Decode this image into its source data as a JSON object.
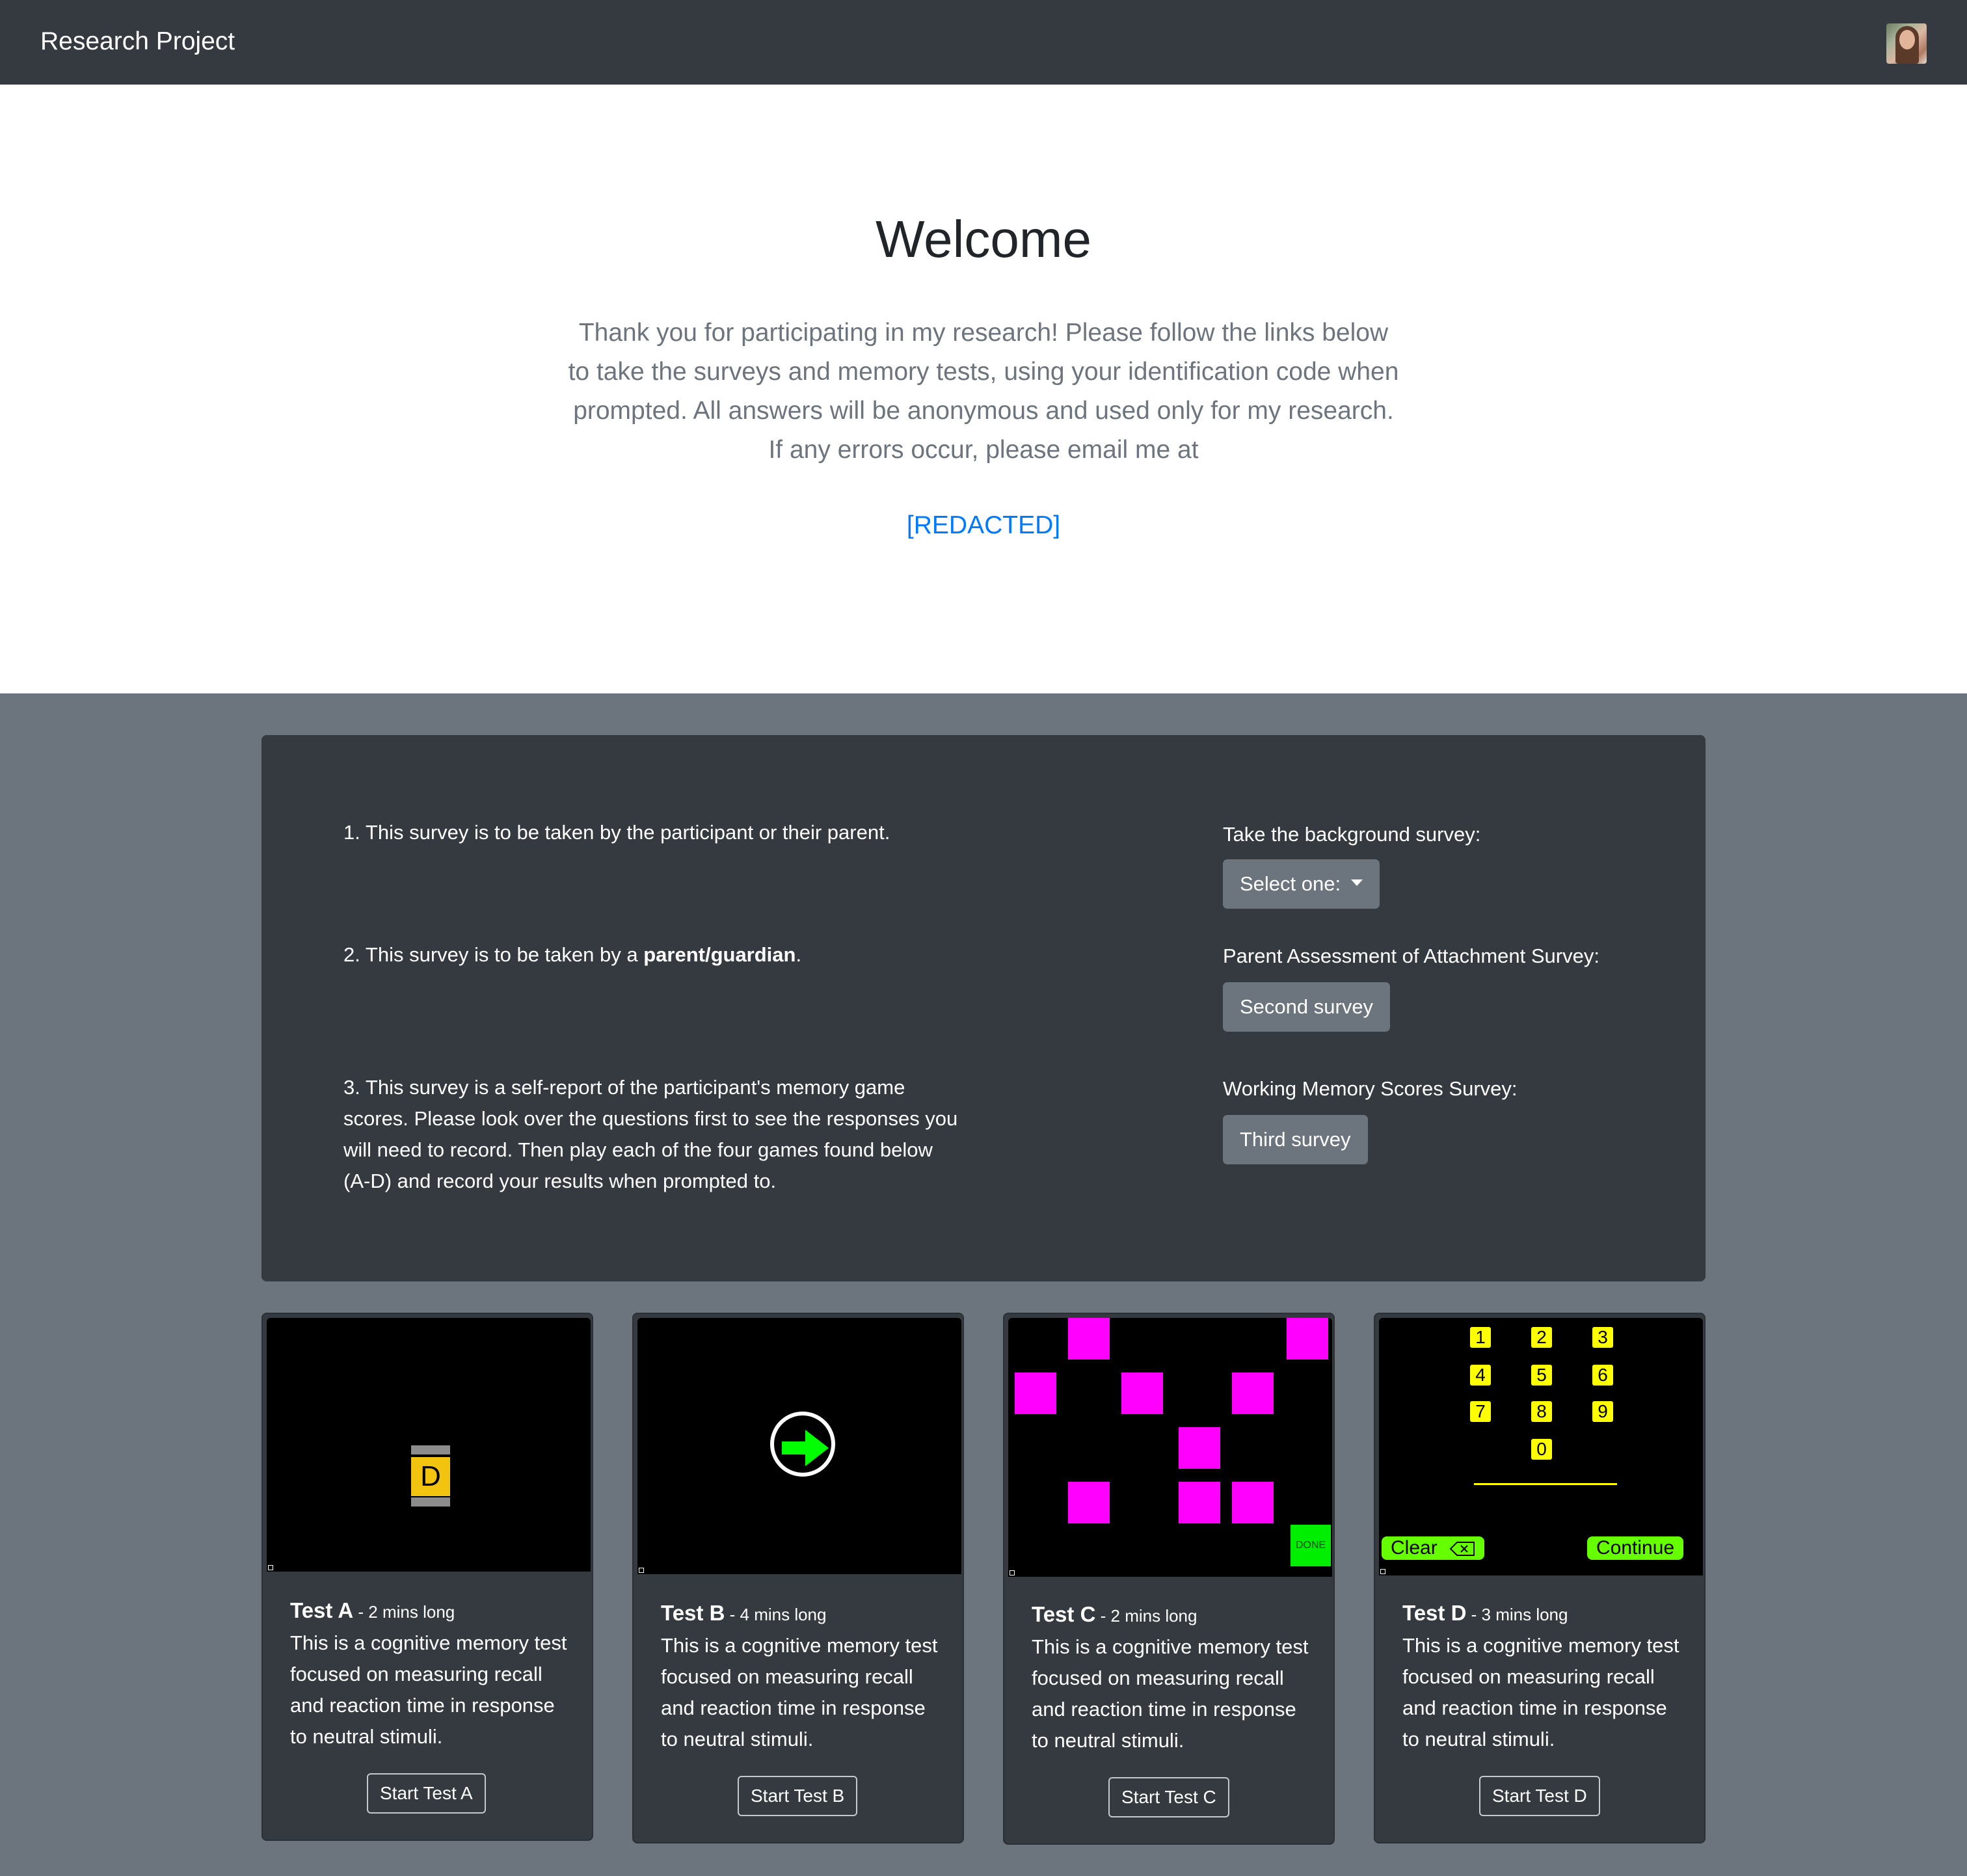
{
  "navbar": {
    "brand": "Research Project"
  },
  "jumbotron": {
    "title": "Welcome",
    "lead": "Thank you for participating in my research! Please follow the links below to take the surveys and memory tests, using your identification code when prompted. All answers will be anonymous and used only for my research. If any errors occur, please email me at",
    "email": "[REDACTED]"
  },
  "surveys": [
    {
      "description_prefix": "1. This survey is to be taken by the participant or their parent.",
      "description_bold": "",
      "description_suffix": "",
      "label": "Take the background survey:",
      "button": "Select one:",
      "dropdown": true
    },
    {
      "description_prefix": "2. This survey is to be taken by a ",
      "description_bold": "parent/guardian",
      "description_suffix": ".",
      "label": "Parent Assessment of Attachment Survey:",
      "button": "Second survey",
      "dropdown": false
    },
    {
      "description_prefix": "3. This survey is a self-report of the participant's memory game scores. Please look over the questions first to see the responses you will need to record. Then play each of the four games found below (A-D) and record your results when prompted to.",
      "description_bold": "",
      "description_suffix": "",
      "label": "Working Memory Scores Survey:",
      "button": "Third survey",
      "dropdown": false
    }
  ],
  "tests": [
    {
      "name": "Test A",
      "duration": " - 2 mins long",
      "description": "This is a cognitive memory test focused on measuring recall and reaction time in response to neutral stimuli.",
      "button": "Start Test A",
      "preview_letter": "D"
    },
    {
      "name": "Test B",
      "duration": " - 4 mins long",
      "description": "This is a cognitive memory test focused on measuring recall and reaction time in response to neutral stimuli.",
      "button": "Start Test B"
    },
    {
      "name": "Test C",
      "duration": " - 2 mins long",
      "description": "This is a cognitive memory test focused on measuring recall and reaction time in response to neutral stimuli.",
      "button": "Start Test C",
      "done_label": "DONE"
    },
    {
      "name": "Test D",
      "duration": " - 3 mins long",
      "description": "This is a cognitive memory test focused on measuring recall and reaction time in response to neutral stimuli.",
      "button": "Start Test D",
      "keys": [
        "1",
        "2",
        "3",
        "4",
        "5",
        "6",
        "7",
        "8",
        "9",
        "0"
      ],
      "clear_label": "Clear",
      "continue_label": "Continue"
    }
  ],
  "colors": {
    "navbar": "#343a40",
    "page_bg": "#6c757d",
    "link": "#007bff",
    "magenta": "#ff00ff",
    "lime": "#66ff00",
    "yellow": "#ffff00"
  }
}
